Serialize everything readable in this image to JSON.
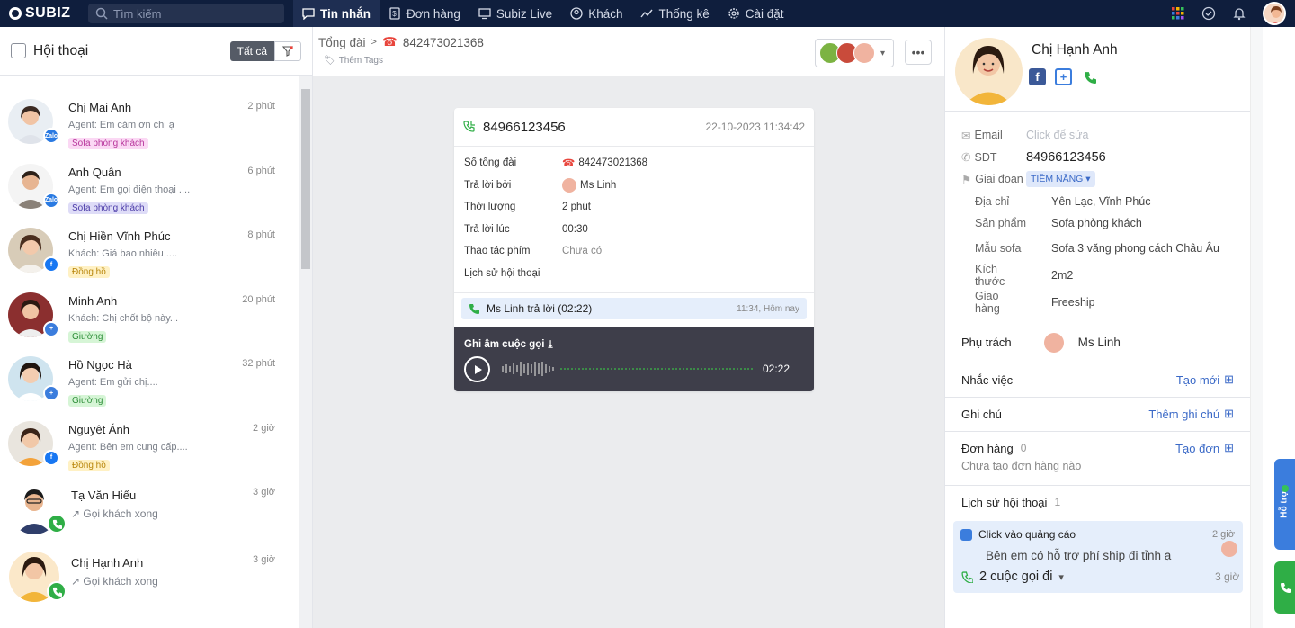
{
  "brand": "SUBIZ",
  "search": {
    "placeholder": "Tìm kiếm"
  },
  "nav": [
    {
      "label": "Tin nhắn",
      "icon": "chat-icon",
      "active": true
    },
    {
      "label": "Đơn hàng",
      "icon": "order-icon"
    },
    {
      "label": "Subiz Live",
      "icon": "live-icon"
    },
    {
      "label": "Khách",
      "icon": "user-icon"
    },
    {
      "label": "Thống kê",
      "icon": "chart-icon"
    },
    {
      "label": "Cài đặt",
      "icon": "gear-icon"
    }
  ],
  "conversations": {
    "title": "Hội thoại",
    "filter_label": "Tất cả",
    "items": [
      {
        "name": "Chị Mai Anh",
        "preview": "Agent: Em cảm ơn chị ạ",
        "time": "2 phút",
        "tag": "Sofa phòng khách",
        "channel": "Zalo"
      },
      {
        "name": "Anh Quân",
        "preview": "Agent: Em gọi điện thoại ....",
        "time": "6 phút",
        "tag": "Sofa phòng khách",
        "channel": "Zalo"
      },
      {
        "name": "Chị Hiền Vĩnh Phúc",
        "preview": "Khách: Giá bao nhiêu ....",
        "time": "8 phút",
        "tag": "Đồng hồ",
        "channel": "facebook"
      },
      {
        "name": "Minh Anh",
        "preview": "Khách: Chị chốt bộ này...",
        "time": "20 phút",
        "tag": "Giường",
        "channel": "subiz"
      },
      {
        "name": "Hồ Ngọc Hà",
        "preview": "Agent: Em gửi chị....",
        "time": "32 phút",
        "tag": "Giường",
        "channel": "subiz"
      },
      {
        "name": "Nguyệt Ánh",
        "preview": "Agent: Bên em cung cấp....",
        "time": "2 giờ",
        "tag": "Đồng hồ",
        "channel": "facebook"
      },
      {
        "name": "Tạ Văn Hiếu",
        "preview": "Gọi khách xong",
        "time": "3 giờ",
        "channel": "call"
      },
      {
        "name": "Chị Hạnh Anh",
        "preview": "Gọi khách xong",
        "time": "3 giờ",
        "channel": "call"
      }
    ]
  },
  "middle": {
    "breadcrumb_root": "Tổng đài",
    "breadcrumb_number": "842473021368",
    "add_tags": "Thêm Tags",
    "call": {
      "phone": "84966123456",
      "datetime": "22-10-2023 11:34:42",
      "rows": [
        {
          "key": "Số tổng đài",
          "value": "842473021368"
        },
        {
          "key": "Trả lời bởi",
          "value": "Ms Linh"
        },
        {
          "key": "Thời lượng",
          "value": "2 phút"
        },
        {
          "key": "Trả lời lúc",
          "value": "00:30"
        },
        {
          "key": "Thao tác phím",
          "value": "Chưa có"
        },
        {
          "key": "Lịch sử hội thoại",
          "value": ""
        }
      ],
      "answered_text": "Ms Linh trả lời (02:22)",
      "answered_time": "11:34, Hôm nay",
      "recording_label": "Ghi âm cuộc gọi",
      "duration": "02:22"
    }
  },
  "profile": {
    "name": "Chị Hạnh Anh",
    "fields": [
      {
        "key": "Email",
        "value": "Click để sửa",
        "placeholder": true
      },
      {
        "key": "SĐT",
        "value": "84966123456"
      },
      {
        "key": "Giai đoạn",
        "value": "TIỀM NĂNG"
      },
      {
        "key": "Địa chỉ",
        "value": "Yên Lạc, Vĩnh Phúc"
      },
      {
        "key": "Sản phẩm",
        "value": "Sofa phòng khách"
      },
      {
        "key": "Mẫu sofa",
        "value": "Sofa 3 văng phong cách Châu Âu"
      },
      {
        "key": "Kích thước",
        "value": "2m2"
      },
      {
        "key": "Giao hàng",
        "value": "Freeship"
      }
    ],
    "owner_label": "Phụ trách",
    "owner_name": "Ms Linh",
    "reminder_label": "Nhắc việc",
    "reminder_action": "Tạo mới",
    "note_label": "Ghi chú",
    "note_action": "Thêm ghi chú",
    "order_label": "Đơn hàng",
    "order_count": "0",
    "order_action": "Tạo đơn",
    "order_empty": "Chưa tạo đơn hàng nào",
    "history_label": "Lịch sử hội thoại",
    "history_count": "1",
    "history": {
      "ad_title": "Click vào quảng cáo",
      "ad_time": "2 giờ",
      "ad_message": "Bên em có hỗ trợ phí ship đi tỉnh ạ",
      "calls": "2 cuộc gọi đi",
      "calls_time": "3 giờ"
    }
  },
  "help_label": "Hỗ trợ",
  "colors": {
    "nav_bg": "#0f1e3d",
    "accent": "#3a69c7",
    "call_green": "#2fae46"
  }
}
